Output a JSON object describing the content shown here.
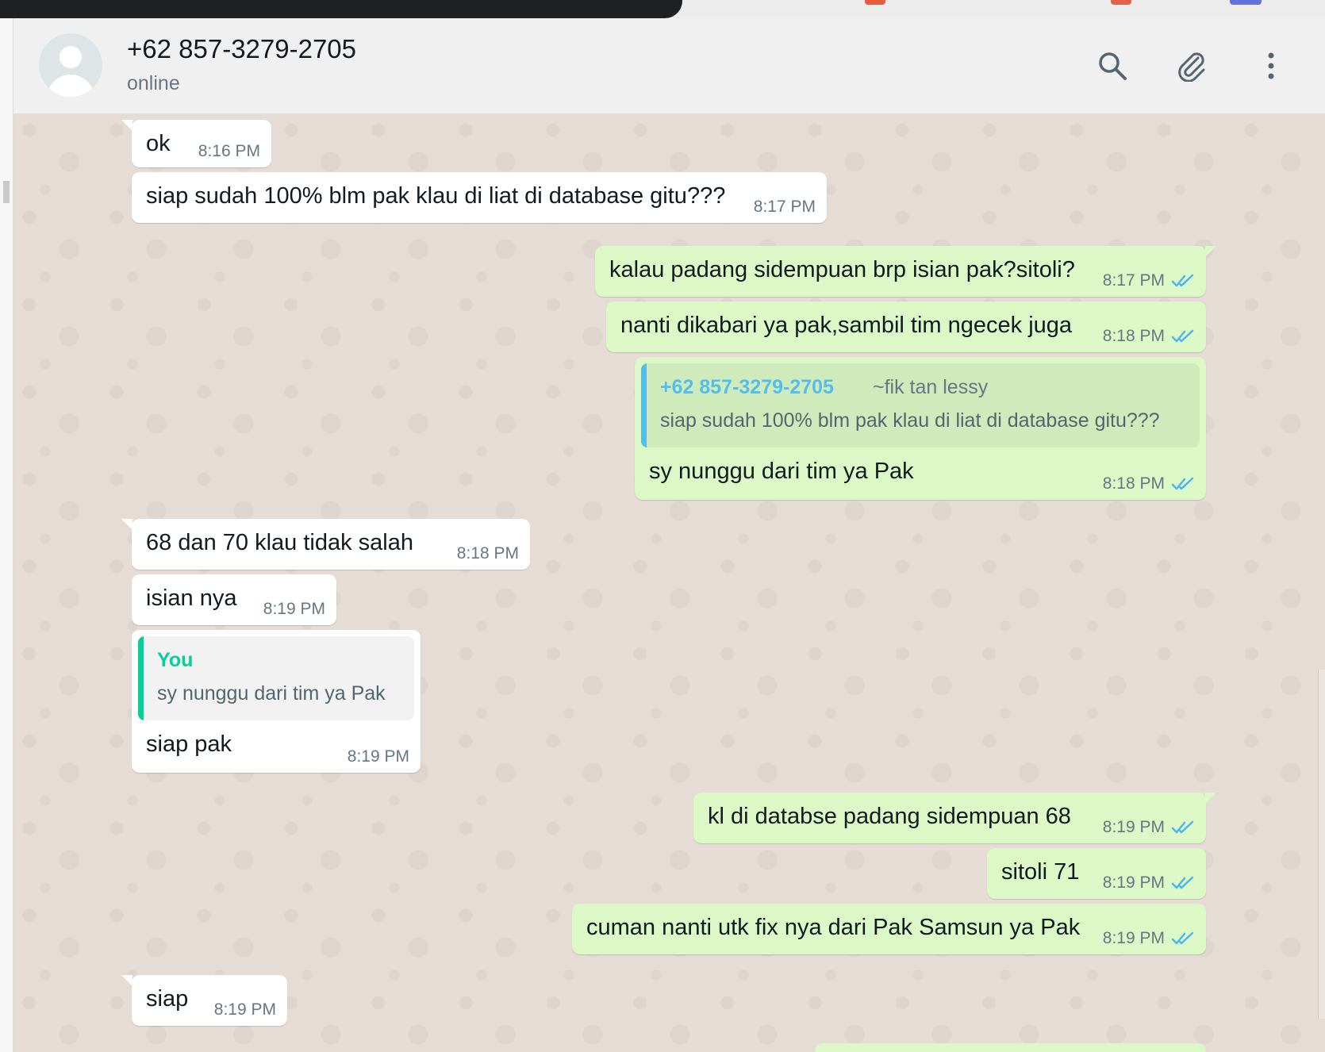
{
  "header": {
    "contact_name": "+62 857-3279-2705",
    "status": "online",
    "icons": [
      "search-icon",
      "attach-icon",
      "menu-icon"
    ]
  },
  "colors": {
    "incoming_bubble": "#ffffff",
    "outgoing_bubble": "#dcf8c6",
    "read_tick": "#4fb6ec",
    "quote_you": "#06cf9c",
    "quote_contact": "#53bdeb",
    "chat_bg": "#e5ddd5"
  },
  "messages": [
    {
      "dir": "in",
      "text": "ok",
      "time": "8:16 PM"
    },
    {
      "dir": "in",
      "text": "siap sudah 100% blm pak klau di liat di database gitu???",
      "time": "8:17 PM"
    },
    {
      "dir": "out",
      "text": "kalau padang sidempuan brp isian pak?sitoli?",
      "time": "8:17 PM",
      "status": "read"
    },
    {
      "dir": "out",
      "text": "nanti dikabari ya pak,sambil tim ngecek juga",
      "time": "8:18 PM",
      "status": "read"
    },
    {
      "dir": "out",
      "text": "sy nunggu dari tim ya Pak",
      "time": "8:18 PM",
      "status": "read",
      "quote": {
        "author": "+62 857-3279-2705",
        "pushname": "~fik tan lessy",
        "text": "siap sudah 100% blm pak klau di liat di database gitu???"
      }
    },
    {
      "dir": "in",
      "text": "68 dan 70 klau tidak salah",
      "time": "8:18 PM"
    },
    {
      "dir": "in",
      "text": "isian nya",
      "time": "8:19 PM"
    },
    {
      "dir": "in",
      "text": "siap pak",
      "time": "8:19 PM",
      "quote": {
        "author": "You",
        "text": "sy nunggu dari tim ya Pak"
      }
    },
    {
      "dir": "out",
      "text": "kl di databse padang sidempuan 68",
      "time": "8:19 PM",
      "status": "read"
    },
    {
      "dir": "out",
      "text": "sitoli 71",
      "time": "8:19 PM",
      "status": "read"
    },
    {
      "dir": "out",
      "text": "cuman nanti utk fix nya dari Pak Samsun ya Pak",
      "time": "8:19 PM",
      "status": "read"
    },
    {
      "dir": "in",
      "text": "siap",
      "time": "8:19 PM"
    }
  ]
}
